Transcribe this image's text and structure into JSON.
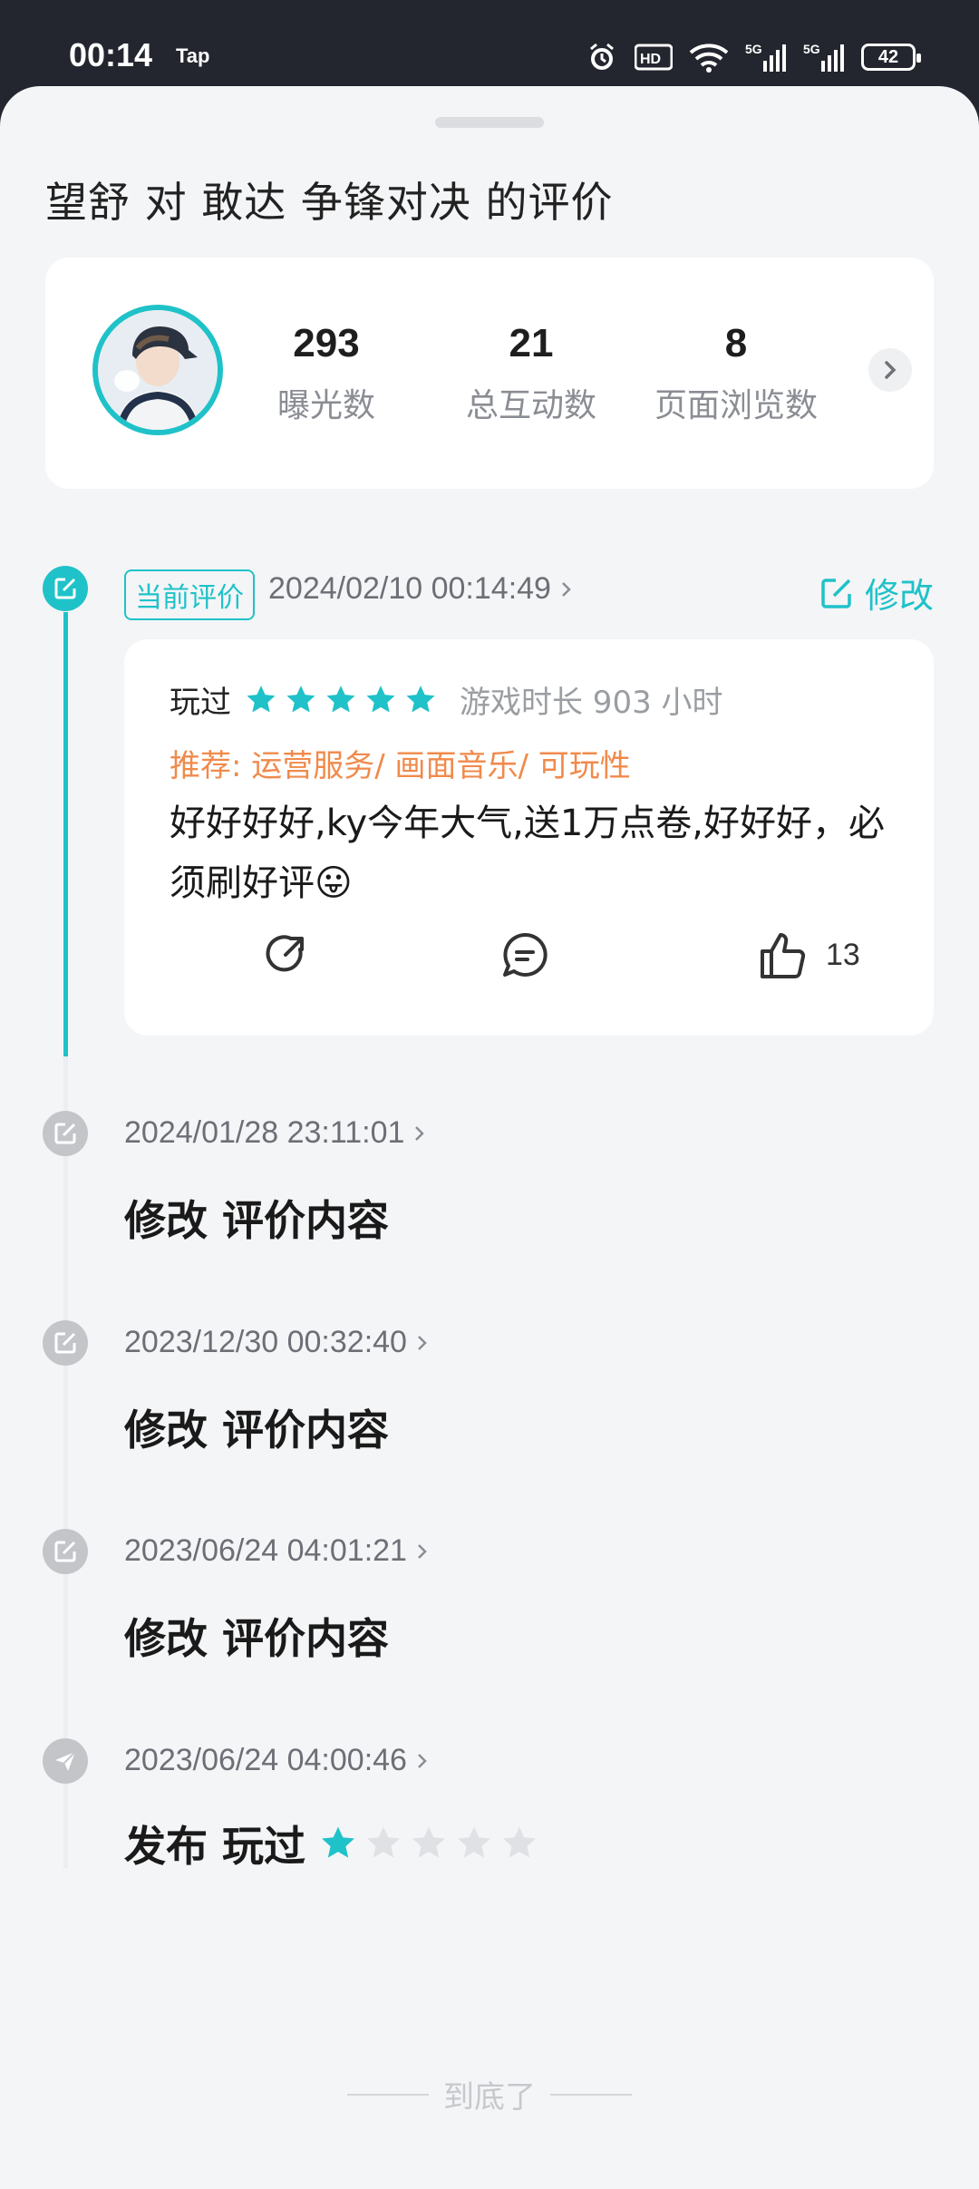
{
  "status_bar": {
    "time": "00:14",
    "app_label": "Tap",
    "battery": "42"
  },
  "page": {
    "title": "望舒 对 敢达 争锋对决 的评价"
  },
  "stats": {
    "items": [
      {
        "value": "293",
        "label": "曝光数"
      },
      {
        "value": "21",
        "label": "总互动数"
      },
      {
        "value": "8",
        "label": "页面浏览数"
      }
    ]
  },
  "current": {
    "badge": "当前评价",
    "date": "2024/02/10 00:14:49",
    "edit_label": "修改",
    "played_label": "玩过",
    "rating": 5,
    "playtime": "游戏时长 903 小时",
    "recommend": "推荐: 运营服务/ 画面音乐/ 可玩性",
    "text": "好好好好,ky今年大气,送1万点卷,好好好，必须刷好评😛",
    "like_count": "13"
  },
  "history": [
    {
      "date": "2024/01/28 23:11:01",
      "title": "修改 评价内容"
    },
    {
      "date": "2023/12/30 00:32:40",
      "title": "修改 评价内容"
    },
    {
      "date": "2023/06/24 04:01:21",
      "title": "修改 评价内容"
    },
    {
      "date": "2023/06/24 04:00:46",
      "title": "发布 玩过",
      "rating": 1
    }
  ],
  "footer": {
    "end_text": "到底了"
  },
  "colors": {
    "accent": "#1fc2c8",
    "recommend": "#f08a4b"
  }
}
